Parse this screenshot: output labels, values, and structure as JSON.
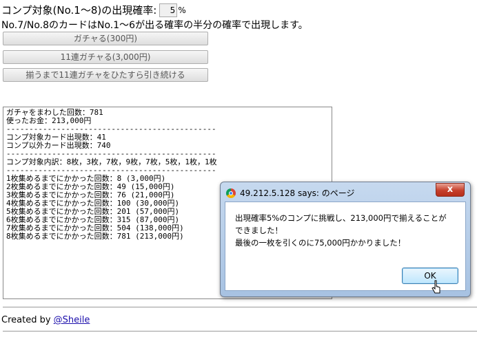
{
  "settings": {
    "rate_label": "コンプ対象(No.1～8)の出現確率:",
    "rate_value": "5",
    "rate_unit": "%",
    "note": "No.7/No.8のカードはNo.1～6が出る確率の半分の確率で出現します。"
  },
  "buttons": {
    "single": "ガチャる(300円)",
    "eleven": "11連ガチャる(3,000円)",
    "until_complete": "揃うまで11連ガチャをひたすら引き続ける"
  },
  "log": {
    "lines": [
      "ガチャをまわした回数：781",
      "使ったお金：213,000円",
      "----------------------------------------------",
      "コンプ対象カード出現数：41",
      "コンプ以外カード出現数：740",
      "----------------------------------------------",
      "コンプ対象内訳：8枚，3枚，7枚，9枚，7枚，5枚，1枚，1枚",
      "----------------------------------------------",
      "1枚集めるまでにかかった回数：8 (3,000円)",
      "2枚集めるまでにかかった回数：49 (15,000円)",
      "3枚集めるまでにかかった回数：76 (21,000円)",
      "4枚集めるまでにかかった回数：100 (30,000円)",
      "5枚集めるまでにかかった回数：201 (57,000円)",
      "6枚集めるまでにかかった回数：315 (87,000円)",
      "7枚集めるまでにかかった回数：504 (138,000円)",
      "8枚集めるまでにかかった回数：781 (213,000円)"
    ]
  },
  "footer": {
    "prefix": "Created by",
    "link": "@Sheile"
  },
  "dialog": {
    "title": "49.212.5.128 says: のページ",
    "close": "x",
    "message_line1": "出現確率5%のコンプに挑戦し、213,000円で揃えることが",
    "message_line2": "できました！",
    "message_line3": "最後の一枚を引くのに75,000円かかりました！",
    "ok": "OK"
  }
}
